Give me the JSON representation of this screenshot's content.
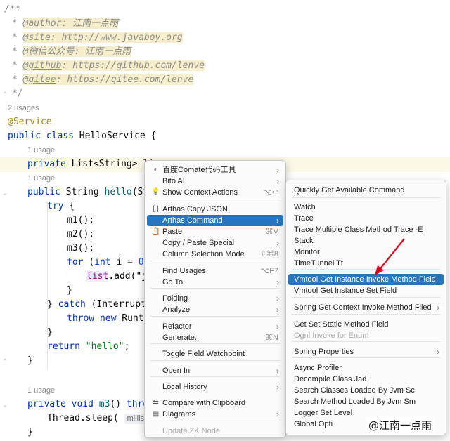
{
  "editor": {
    "usages": {
      "class_usages": "2 usages",
      "field_usages": "1 usage",
      "hello_usages": "1 usage",
      "m3_usages": "1 usage"
    },
    "code": {
      "doc_open": "/**",
      "doc_author_tag": "@author",
      "doc_author_val": ": 江南一点雨",
      "doc_site_tag": "@site",
      "doc_site_val": ": http://www.javaboy.org",
      "doc_wechat": "@微信公众号: 江南一点雨",
      "doc_github_tag": "@github",
      "doc_github_val": ": https://github.com/lenve",
      "doc_gitee_tag": "@gitee",
      "doc_gitee_val": ": https://gitee.com/lenve",
      "doc_close": " */",
      "service_ann": "@Service",
      "kw_public": "public",
      "kw_class": "class",
      "class_name": " HelloService {",
      "kw_private": "private",
      "field_type": " List<String> ",
      "field_name": "lis",
      "method_ret": " String ",
      "method_name": "hello",
      "method_rest": "(Stri",
      "kw_try": "try",
      "brace_open": " {",
      "m1": "m1();",
      "m2": "m2();",
      "m3": "m3();",
      "kw_for": "for",
      "for_open": " (",
      "kw_int": "int",
      "for_var": " i = ",
      "for_num": "0",
      "for_semi": ";",
      "list_field": "list",
      "list_add": ".add(\"ja",
      "brace_close": "}",
      "catch_close": "} ",
      "kw_catch": "catch",
      "catch_rest": " (Interrupted",
      "kw_throw": "throw",
      "kw_new": "new",
      "runtime": " Runtim",
      "kw_return": "return",
      "hello_str": "\"hello\"",
      "semicolon": ";",
      "kw_void": "void",
      "m3_name": "m3",
      "m3_rest": "() ",
      "kw_throws": "throws",
      "thread_sleep": "Thread.sleep(",
      "millis_hint": "millis: 3",
      "final_brace": "}"
    }
  },
  "context_menu": {
    "items": [
      {
        "label": "百度Comate代码工具",
        "icon": "comate-icon",
        "arrow": true
      },
      {
        "label": "Bito AI",
        "arrow": true
      },
      {
        "label": "Show Context Actions",
        "icon": "bulb-icon",
        "shortcut": "⌥↩"
      },
      {
        "label": "Arthas Copy JSON",
        "icon": "braces-icon"
      },
      {
        "label": "Arthas Command",
        "arrow": true,
        "selected": true
      },
      {
        "label": "Paste",
        "icon": "clipboard-icon",
        "shortcut": "⌘V"
      },
      {
        "label": "Copy / Paste Special",
        "arrow": true
      },
      {
        "label": "Column Selection Mode",
        "shortcut": "⇧⌘8"
      },
      {
        "label": "Find Usages",
        "shortcut": "⌥F7"
      },
      {
        "label": "Go To",
        "arrow": true
      },
      {
        "label": "Folding",
        "arrow": true
      },
      {
        "label": "Analyze",
        "arrow": true
      },
      {
        "label": "Refactor",
        "arrow": true
      },
      {
        "label": "Generate...",
        "shortcut": "⌘N"
      },
      {
        "label": "Toggle Field Watchpoint"
      },
      {
        "label": "Open In",
        "arrow": true
      },
      {
        "label": "Local History",
        "arrow": true
      },
      {
        "label": "Compare with Clipboard",
        "icon": "compare-icon"
      },
      {
        "label": "Diagrams",
        "icon": "diagram-icon",
        "arrow": true
      },
      {
        "label": "Update ZK Node",
        "disabled": true
      }
    ]
  },
  "submenu": {
    "items": [
      {
        "label": "Quickly Get Available Command"
      },
      {
        "label": "Watch"
      },
      {
        "label": "Trace"
      },
      {
        "label": "Trace Multiple Class Method Trace -E"
      },
      {
        "label": "Stack"
      },
      {
        "label": "Monitor"
      },
      {
        "label": "TimeTunnel Tt"
      },
      {
        "label": "Vmtool Get Instance Invoke Method Field",
        "selected": true
      },
      {
        "label": "Vmtool Get Instance Set Field"
      },
      {
        "label": "Spring Get Context Invoke Method Filed",
        "arrow": true
      },
      {
        "label": "Get Set Static Method Field"
      },
      {
        "label": "Ognl Invoke for Enum",
        "disabled": true
      },
      {
        "label": "Spring Properties",
        "arrow": true
      },
      {
        "label": "Async Profiler"
      },
      {
        "label": "Decompile Class Jad"
      },
      {
        "label": "Search Classes Loaded By Jvm Sc"
      },
      {
        "label": "Search Method Loaded By Jvm Sm"
      },
      {
        "label": "Logger Set Level"
      },
      {
        "label": "Global Opti"
      }
    ]
  },
  "watermark": "@江南一点雨",
  "colors": {
    "selection": "#2675bf",
    "keyword": "#0033b3",
    "annotation": "#9e880d",
    "string": "#067d17",
    "arrow": "#e0001a"
  }
}
